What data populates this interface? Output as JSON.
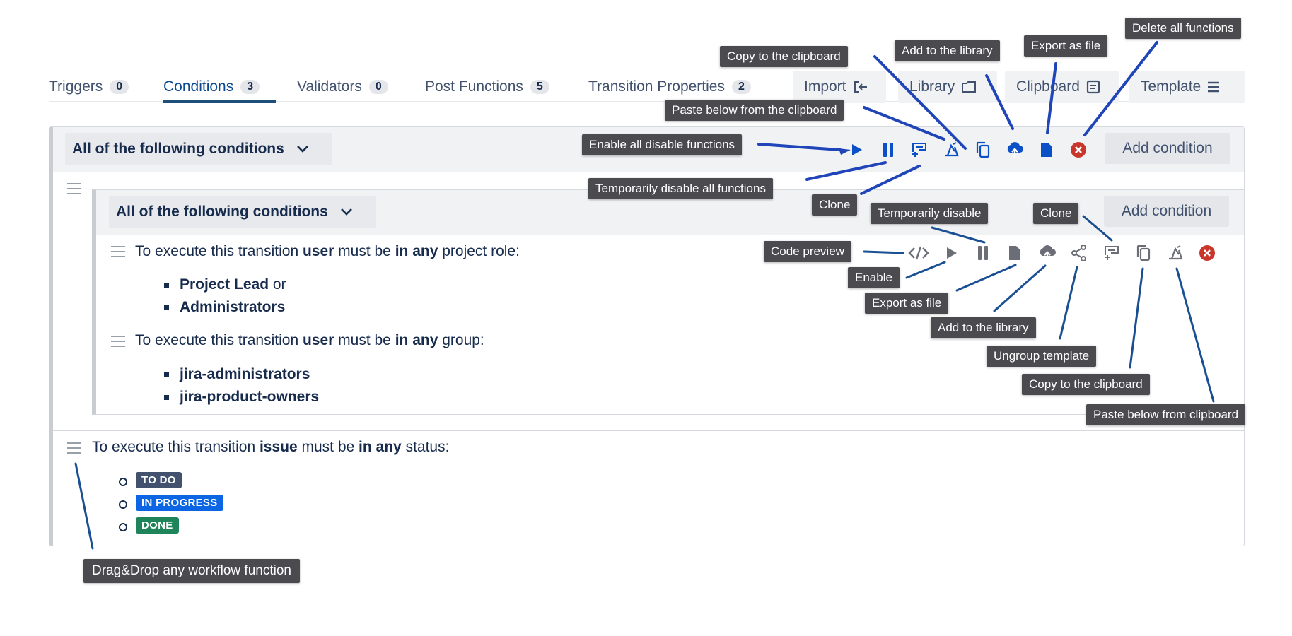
{
  "tabs": [
    {
      "label": "Triggers",
      "count": "0"
    },
    {
      "label": "Conditions",
      "count": "3"
    },
    {
      "label": "Validators",
      "count": "0"
    },
    {
      "label": "Post Functions",
      "count": "5"
    },
    {
      "label": "Transition Properties",
      "count": "2"
    }
  ],
  "toolbar": {
    "import": "Import",
    "library": "Library",
    "clipboard": "Clipboard",
    "template": "Template"
  },
  "outer_group": {
    "header": "All of the following conditions",
    "add": "Add condition"
  },
  "inner_group": {
    "header": "All of the following conditions",
    "add": "Add condition"
  },
  "cond1": {
    "p1": "To execute this transition ",
    "b1": "user",
    "p2": " must be ",
    "b2": "in any",
    "p3": " project role:",
    "items": [
      "Project Lead",
      "Administrators"
    ],
    "or": " or"
  },
  "cond2": {
    "p1": "To execute this transition ",
    "b1": "user",
    "p2": " must be ",
    "b2": "in any",
    "p3": " group:",
    "items": [
      "jira-administrators",
      "jira-product-owners"
    ]
  },
  "cond3": {
    "p1": "To execute this transition ",
    "b1": "issue",
    "p2": " must be ",
    "b2": "in any",
    "p3": " status:",
    "statuses": [
      {
        "label": "TO DO",
        "color": "#42526e"
      },
      {
        "label": "IN PROGRESS",
        "color": "#0c66e4"
      },
      {
        "label": "DONE",
        "color": "#1f845a"
      }
    ]
  },
  "tooltips": {
    "copy_clipboard_top": "Copy to the clipboard",
    "add_library_top": "Add to the library",
    "export_file_top": "Export as file",
    "delete_all": "Delete all functions",
    "paste_below_top": "Paste below from the clipboard",
    "enable_all": "Enable all disable functions",
    "temp_disable_all": "Temporarily disable all functions",
    "clone_top": "Clone",
    "temp_disable": "Temporarily disable",
    "clone_row": "Clone",
    "code_preview": "Code preview",
    "enable": "Enable",
    "export_file_row": "Export as file",
    "add_library_row": "Add to the library",
    "ungroup": "Ungroup template",
    "copy_clipboard_row": "Copy to the clipboard",
    "paste_below_row": "Paste below from clipboard",
    "drag_drop": "Drag&Drop any workflow function"
  },
  "colors": {
    "accent": "#0c4a8f",
    "icon_blue": "#0b50c6",
    "delete_red": "#c9372c",
    "icon_gray": "#6b6e76",
    "tooltip_bg": "#4a4a4f"
  }
}
